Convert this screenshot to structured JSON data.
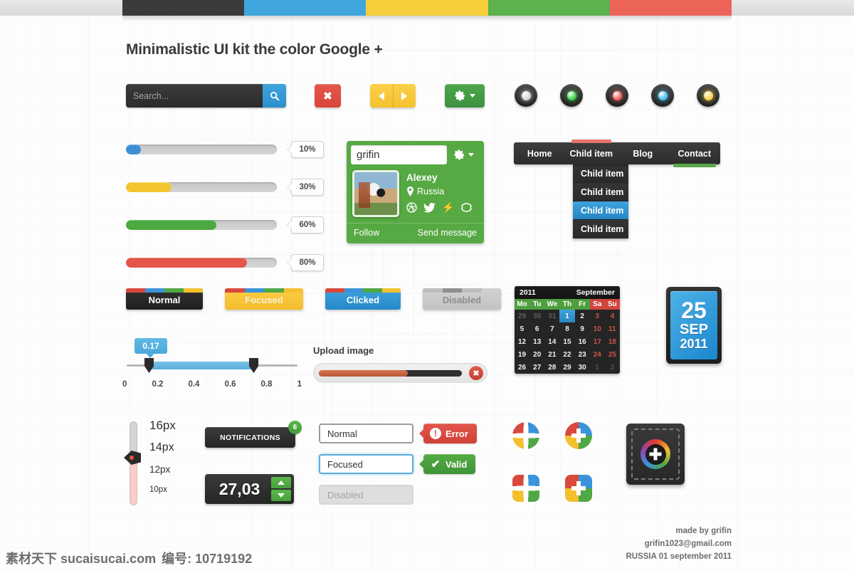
{
  "topbar": {
    "segments": [
      "#3b3b3b",
      "#3fa6de",
      "#f7cf3c",
      "#5cb24c",
      "#ec6358"
    ]
  },
  "title": "Minimalistic UI kit the color Google +",
  "search": {
    "value": "",
    "placeholder": "Search...",
    "icon": "search-icon"
  },
  "toolbar": {
    "close_icon": "✖",
    "prev_icon": "triangle-left-icon",
    "next_icon": "triangle-right-icon",
    "gear_icon": "gear-icon",
    "caret_icon": "caret-down-icon"
  },
  "leds": [
    {
      "name": "led-white",
      "color": "#d8d8d8"
    },
    {
      "name": "led-green",
      "color": "#3fd24a"
    },
    {
      "name": "led-red",
      "color": "#f2675c"
    },
    {
      "name": "led-blue",
      "color": "#4cc0f0"
    },
    {
      "name": "led-yellow",
      "color": "#ffd34d"
    }
  ],
  "progress": [
    {
      "label": "10%",
      "value": 10,
      "color": "#3b8fd4"
    },
    {
      "label": "30%",
      "value": 30,
      "color": "#f4c52f"
    },
    {
      "label": "60%",
      "value": 60,
      "color": "#4ba93f"
    },
    {
      "label": "80%",
      "value": 80,
      "color": "#e4554a"
    }
  ],
  "profile": {
    "username": "grifin",
    "gear_icon": "gear-icon",
    "caret_icon": "caret-down-icon",
    "avatar_name": "avatar",
    "name": "Alexey",
    "location": "Russia",
    "location_icon": "map-pin-icon",
    "socials": [
      "dribbble-icon",
      "twitter-icon",
      "forrst-icon",
      "rss-icon"
    ],
    "follow_label": "Follow",
    "message_label": "Send message"
  },
  "nav": {
    "items": [
      {
        "label": "Home",
        "accent": "none"
      },
      {
        "label": "Child item",
        "accent": "top"
      },
      {
        "label": "Blog",
        "accent": "none"
      },
      {
        "label": "Contact",
        "accent": "bottom"
      }
    ],
    "dropdown": [
      {
        "label": "Child item",
        "selected": false
      },
      {
        "label": "Child item",
        "selected": false
      },
      {
        "label": "Child item",
        "selected": true
      },
      {
        "label": "Child item",
        "selected": false
      }
    ],
    "accent_top_color": "#e8736a",
    "accent_bottom_color": "#5aa84a"
  },
  "state_buttons": [
    {
      "label": "Normal",
      "bg": "linear-gradient(#323232, #1f1f1f)",
      "text": "#ffffff",
      "stripe": [
        "#d8483d",
        "#3b94d9",
        "#4fa845",
        "#f4c02e"
      ]
    },
    {
      "label": "Focused",
      "bg": "linear-gradient(#fbcd47, #f4be2c)",
      "text": "#f7f0d6",
      "stripe": [
        "#d8483d",
        "#3b94d9",
        "#4fa845",
        "#f4c02e"
      ]
    },
    {
      "label": "Clicked",
      "bg": "linear-gradient(#3fa3dd, #2589c8)",
      "text": "#ffffff",
      "stripe": [
        "#d8483d",
        "#3b94d9",
        "#4fa845",
        "#f4c02e"
      ]
    },
    {
      "label": "Disabled",
      "bg": "linear-gradient(#d2d2d2, #c2c2c2)",
      "text": "#8c8c8c",
      "stripe": [
        "#bdbdbd",
        "#8f8f8f",
        "#bdbdbd",
        "#d0d0d0"
      ]
    }
  ],
  "slider": {
    "tooltip": "0.17",
    "ticks": [
      "0",
      "0.2",
      "0.4",
      "0.6",
      "0.8",
      "1"
    ],
    "low": 0.17,
    "high": 0.8
  },
  "upload": {
    "label": "Upload image",
    "percent": 62,
    "cancel_icon": "✖"
  },
  "calendar": {
    "year": "2011",
    "month": "September",
    "dow": [
      "Mo",
      "Tu",
      "We",
      "Th",
      "Fr",
      "Sa",
      "Su"
    ],
    "weeks": [
      [
        {
          "d": "29",
          "t": "mut"
        },
        {
          "d": "30",
          "t": "mut"
        },
        {
          "d": "31",
          "t": "mut"
        },
        {
          "d": "1",
          "t": "sel"
        },
        {
          "d": "2",
          "t": "day"
        },
        {
          "d": "3",
          "t": "wk"
        },
        {
          "d": "4",
          "t": "wk"
        }
      ],
      [
        {
          "d": "5",
          "t": "day"
        },
        {
          "d": "6",
          "t": "day"
        },
        {
          "d": "7",
          "t": "day"
        },
        {
          "d": "8",
          "t": "day"
        },
        {
          "d": "9",
          "t": "day"
        },
        {
          "d": "10",
          "t": "wk"
        },
        {
          "d": "11",
          "t": "wk"
        }
      ],
      [
        {
          "d": "12",
          "t": "day"
        },
        {
          "d": "13",
          "t": "day"
        },
        {
          "d": "14",
          "t": "day"
        },
        {
          "d": "15",
          "t": "day"
        },
        {
          "d": "16",
          "t": "day"
        },
        {
          "d": "17",
          "t": "wk"
        },
        {
          "d": "18",
          "t": "wk"
        }
      ],
      [
        {
          "d": "19",
          "t": "day"
        },
        {
          "d": "20",
          "t": "day"
        },
        {
          "d": "21",
          "t": "day"
        },
        {
          "d": "22",
          "t": "day"
        },
        {
          "d": "23",
          "t": "day"
        },
        {
          "d": "24",
          "t": "wk"
        },
        {
          "d": "25",
          "t": "wk"
        }
      ],
      [
        {
          "d": "26",
          "t": "day"
        },
        {
          "d": "27",
          "t": "day"
        },
        {
          "d": "28",
          "t": "day"
        },
        {
          "d": "29",
          "t": "day"
        },
        {
          "d": "30",
          "t": "day"
        },
        {
          "d": "1",
          "t": "wkmut"
        },
        {
          "d": "2",
          "t": "wkmut"
        }
      ]
    ]
  },
  "date_badge": {
    "day": "25",
    "month": "SEP",
    "year": "2011"
  },
  "font_slider": {
    "sizes": [
      "16px",
      "14px",
      "12px",
      "10px"
    ],
    "selected": "14px"
  },
  "notifications": {
    "label": "NOTIFICATIONS",
    "count": "6"
  },
  "stepper": {
    "value": "27,03",
    "up_icon": "triangle-up-icon",
    "down_icon": "triangle-down-icon"
  },
  "form": {
    "rows": [
      {
        "input": "Normal",
        "state": "normal",
        "tag": "Error",
        "tag_state": "err",
        "tag_icon": "!"
      },
      {
        "input": "Focused",
        "state": "focused",
        "tag": "Valid",
        "tag_state": "ok",
        "tag_icon": "✔"
      },
      {
        "input": "Disabled",
        "state": "disabled",
        "tag": null,
        "tag_state": null,
        "tag_icon": null
      }
    ]
  },
  "gicons": [
    {
      "name": "gplus-circle-split-icon",
      "shape": "round",
      "variant": "split"
    },
    {
      "name": "gplus-circle-icon",
      "shape": "round",
      "variant": "solid"
    },
    {
      "name": "gplus-square-split-icon",
      "shape": "rounded",
      "variant": "split"
    },
    {
      "name": "gplus-square-icon",
      "shape": "rounded",
      "variant": "solid"
    }
  ],
  "add_tile": {
    "name": "add-button-tile",
    "icon": "plus-icon"
  },
  "footer": {
    "line1": "made by grifin",
    "line2": "grifin1023@gmail.com",
    "line3": "RUSSIA 01 september 2011"
  },
  "watermark": {
    "site": "素材天下 sucaisucai.com",
    "code": "编号: 10719192"
  }
}
